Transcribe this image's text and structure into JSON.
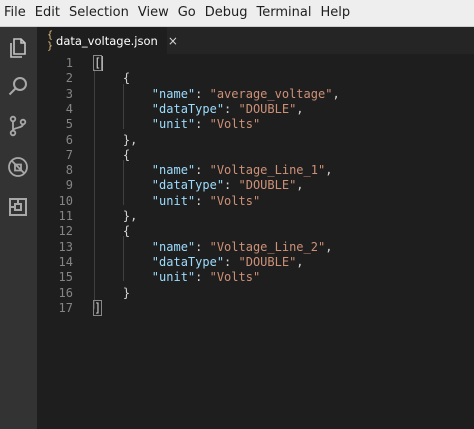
{
  "menu": [
    "File",
    "Edit",
    "Selection",
    "View",
    "Go",
    "Debug",
    "Terminal",
    "Help"
  ],
  "activity_icons": [
    "files-icon",
    "search-icon",
    "source-control-icon",
    "debug-icon",
    "extensions-icon"
  ],
  "tab": {
    "icon_text": "{ }",
    "label": "data_voltage.json",
    "close": "×"
  },
  "editor": {
    "lines": [
      {
        "n": "1",
        "tokens": [
          {
            "t": "p",
            "v": "["
          }
        ]
      },
      {
        "n": "2",
        "tokens": [
          {
            "t": "p",
            "v": "    {"
          }
        ]
      },
      {
        "n": "3",
        "tokens": [
          {
            "t": "p",
            "v": "        "
          },
          {
            "t": "k",
            "v": "\"name\""
          },
          {
            "t": "p",
            "v": ": "
          },
          {
            "t": "s",
            "v": "\"average_voltage\""
          },
          {
            "t": "p",
            "v": ","
          }
        ]
      },
      {
        "n": "4",
        "tokens": [
          {
            "t": "p",
            "v": "        "
          },
          {
            "t": "k",
            "v": "\"dataType\""
          },
          {
            "t": "p",
            "v": ": "
          },
          {
            "t": "s",
            "v": "\"DOUBLE\""
          },
          {
            "t": "p",
            "v": ","
          }
        ]
      },
      {
        "n": "5",
        "tokens": [
          {
            "t": "p",
            "v": "        "
          },
          {
            "t": "k",
            "v": "\"unit\""
          },
          {
            "t": "p",
            "v": ": "
          },
          {
            "t": "s",
            "v": "\"Volts\""
          }
        ]
      },
      {
        "n": "6",
        "tokens": [
          {
            "t": "p",
            "v": "    },"
          }
        ]
      },
      {
        "n": "7",
        "tokens": [
          {
            "t": "p",
            "v": "    {"
          }
        ]
      },
      {
        "n": "8",
        "tokens": [
          {
            "t": "p",
            "v": "        "
          },
          {
            "t": "k",
            "v": "\"name\""
          },
          {
            "t": "p",
            "v": ": "
          },
          {
            "t": "s",
            "v": "\"Voltage_Line_1\""
          },
          {
            "t": "p",
            "v": ","
          }
        ]
      },
      {
        "n": "9",
        "tokens": [
          {
            "t": "p",
            "v": "        "
          },
          {
            "t": "k",
            "v": "\"dataType\""
          },
          {
            "t": "p",
            "v": ": "
          },
          {
            "t": "s",
            "v": "\"DOUBLE\""
          },
          {
            "t": "p",
            "v": ","
          }
        ]
      },
      {
        "n": "10",
        "tokens": [
          {
            "t": "p",
            "v": "        "
          },
          {
            "t": "k",
            "v": "\"unit\""
          },
          {
            "t": "p",
            "v": ": "
          },
          {
            "t": "s",
            "v": "\"Volts\""
          }
        ]
      },
      {
        "n": "11",
        "tokens": [
          {
            "t": "p",
            "v": "    },"
          }
        ]
      },
      {
        "n": "12",
        "tokens": [
          {
            "t": "p",
            "v": "    {"
          }
        ]
      },
      {
        "n": "13",
        "tokens": [
          {
            "t": "p",
            "v": "        "
          },
          {
            "t": "k",
            "v": "\"name\""
          },
          {
            "t": "p",
            "v": ": "
          },
          {
            "t": "s",
            "v": "\"Voltage_Line_2\""
          },
          {
            "t": "p",
            "v": ","
          }
        ]
      },
      {
        "n": "14",
        "tokens": [
          {
            "t": "p",
            "v": "        "
          },
          {
            "t": "k",
            "v": "\"dataType\""
          },
          {
            "t": "p",
            "v": ": "
          },
          {
            "t": "s",
            "v": "\"DOUBLE\""
          },
          {
            "t": "p",
            "v": ","
          }
        ]
      },
      {
        "n": "15",
        "tokens": [
          {
            "t": "p",
            "v": "        "
          },
          {
            "t": "k",
            "v": "\"unit\""
          },
          {
            "t": "p",
            "v": ": "
          },
          {
            "t": "s",
            "v": "\"Volts\""
          }
        ]
      },
      {
        "n": "16",
        "tokens": [
          {
            "t": "p",
            "v": "    }"
          }
        ]
      },
      {
        "n": "17",
        "tokens": [
          {
            "t": "p",
            "v": "]"
          }
        ]
      }
    ]
  },
  "colors": {
    "editor_bg": "#1e1e1e",
    "activity_bg": "#333333",
    "key": "#9cdcfe",
    "string": "#ce9178",
    "punct": "#d4d4d4",
    "line_number": "#858585"
  }
}
